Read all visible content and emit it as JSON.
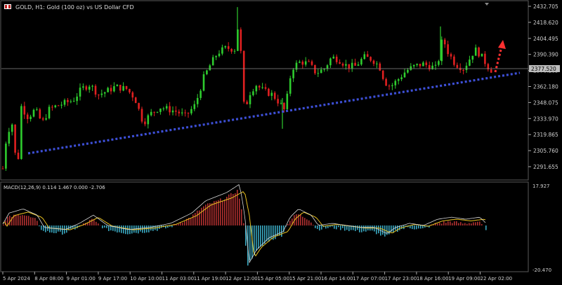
{
  "header": {
    "symbol_label": "GOLD, H1:  Gold (100 oz) vs US Dollar CFD"
  },
  "price_axis": {
    "ticks": [
      "2432.705",
      "2418.620",
      "2404.495",
      "2390.390",
      "2376.285",
      "2362.180",
      "2348.075",
      "2333.970",
      "2319.865",
      "2305.760",
      "2291.655"
    ],
    "current_price": "2377.520"
  },
  "macd": {
    "label": "MACD(12,26,9) 0.114 1.467 0.000 -2.706",
    "max_label": "17.927",
    "min_label": "-20.470"
  },
  "time_axis": {
    "ticks": [
      "5 Apr 2024",
      "8 Apr 08:00",
      "9 Apr 01:00",
      "9 Apr 17:00",
      "10 Apr 10:00",
      "11 Apr 03:00",
      "11 Apr 19:00",
      "12 Apr 12:00",
      "15 Apr 05:00",
      "15 Apr 21:00",
      "16 Apr 14:00",
      "17 Apr 07:00",
      "17 Apr 23:00",
      "18 Apr 16:00",
      "19 Apr 09:00",
      "22 Apr 02:00"
    ]
  },
  "colors": {
    "background": "#000000",
    "bull": "#2ecc2e",
    "bear": "#e02020",
    "trendline": "#3d4fd6",
    "arrow": "#ff3030",
    "macd_pos": "#b03030",
    "macd_neg": "#3aa8c0",
    "signal_yellow": "#e8c020",
    "macd_line": "#d8d8d8",
    "grid_text": "#cfcfcf"
  }
}
